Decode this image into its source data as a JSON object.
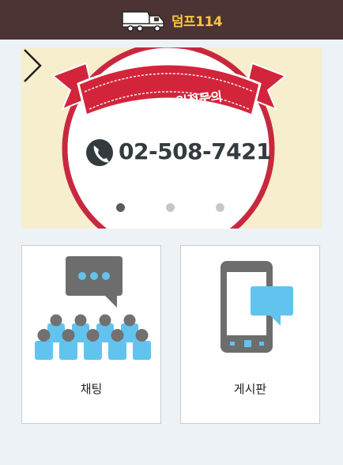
{
  "header": {
    "logo_icon": "dump-truck-icon",
    "title": "덤프114"
  },
  "banner": {
    "ribbon_text": "덤프114 입점문의",
    "phone_icon": "phone-icon",
    "phone_number": "02-508-7421",
    "next_icon": "chevron-right-icon",
    "slide_count": 3,
    "active_slide": 1
  },
  "menu": {
    "chat": {
      "label": "채팅",
      "icon": "group-chat-icon"
    },
    "board": {
      "label": "게시판",
      "icon": "mobile-message-icon"
    }
  },
  "colors": {
    "header_bg": "#4b3433",
    "brand_yellow": "#f6c343",
    "ribbon_red": "#d2253c",
    "banner_bg": "#f6eecd",
    "icon_blue": "#62c3ef",
    "icon_gray": "#717171"
  }
}
